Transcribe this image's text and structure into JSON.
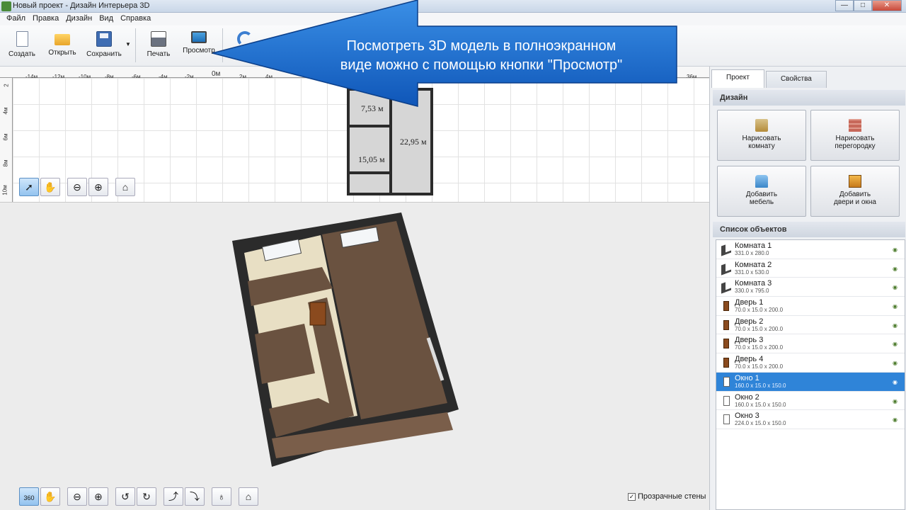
{
  "window": {
    "title": "Новый проект - Дизайн Интерьера 3D"
  },
  "menu": [
    "Файл",
    "Правка",
    "Дизайн",
    "Вид",
    "Справка"
  ],
  "toolbar": {
    "create": "Создать",
    "open": "Открыть",
    "save": "Сохранить",
    "print": "Печать",
    "preview": "Просмотр"
  },
  "callout": {
    "line1": "Посмотреть 3D модель в полноэкранном",
    "line2": "виде можно с помощью кнопки \"Просмотр\""
  },
  "plan": {
    "ruler_top": [
      "-14м",
      "-12м",
      "-10м",
      "-8м",
      "-6м",
      "-4м",
      "-2м",
      "0м",
      "2м",
      "4м",
      "36м"
    ],
    "ruler_left": [
      "2",
      "4м",
      "6м",
      "8м",
      "10м"
    ],
    "rooms": [
      "7,53 м",
      "22,95 м",
      "15,05 м"
    ]
  },
  "view3d": {
    "transparent_walls": "Прозрачные стены"
  },
  "panel": {
    "tabs": [
      "Проект",
      "Свойства"
    ],
    "design_title": "Дизайн",
    "buttons": {
      "draw_room": "Нарисовать\nкомнату",
      "draw_partition": "Нарисовать\nперегородку",
      "add_furniture": "Добавить\nмебель",
      "add_doors": "Добавить\nдвери и окна"
    },
    "objects_title": "Список объектов",
    "objects": [
      {
        "name": "Комната 1",
        "dim": "331.0 x 280.0",
        "type": "room"
      },
      {
        "name": "Комната 2",
        "dim": "331.0 x 530.0",
        "type": "room"
      },
      {
        "name": "Комната 3",
        "dim": "330.0 x 795.0",
        "type": "room"
      },
      {
        "name": "Дверь 1",
        "dim": "70.0 x 15.0 x 200.0",
        "type": "door"
      },
      {
        "name": "Дверь 2",
        "dim": "70.0 x 15.0 x 200.0",
        "type": "door"
      },
      {
        "name": "Дверь 3",
        "dim": "70.0 x 15.0 x 200.0",
        "type": "door"
      },
      {
        "name": "Дверь 4",
        "dim": "70.0 x 15.0 x 200.0",
        "type": "door"
      },
      {
        "name": "Окно 1",
        "dim": "160.0 x 15.0 x 150.0",
        "type": "window",
        "selected": true
      },
      {
        "name": "Окно 2",
        "dim": "160.0 x 15.0 x 150.0",
        "type": "window"
      },
      {
        "name": "Окно 3",
        "dim": "224.0 x 15.0 x 150.0",
        "type": "window"
      }
    ]
  },
  "colors": {
    "accent": "#2f84d8",
    "callout": "#1565c8",
    "floor": "#6a5240"
  }
}
